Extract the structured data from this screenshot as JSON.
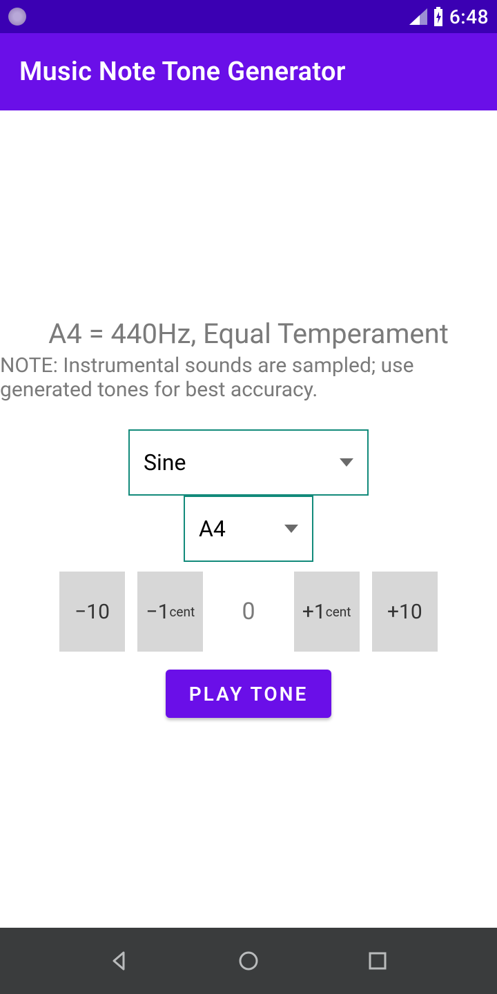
{
  "status": {
    "clock": "6:48"
  },
  "app": {
    "title": "Music Note Tone Generator"
  },
  "main": {
    "heading": "A4 = 440Hz, Equal Temperament",
    "note": "NOTE: Instrumental sounds are sampled; use generated tones for best accuracy.",
    "waveform": "Sine",
    "note_select": "A4",
    "cents_value": "0",
    "buttons": {
      "minus10": "−10",
      "minus1_big": "−1",
      "minus1_small": "cent",
      "plus1_big": "+1",
      "plus1_small": "cent",
      "plus10": "+10"
    },
    "play_label": "PLAY TONE"
  }
}
